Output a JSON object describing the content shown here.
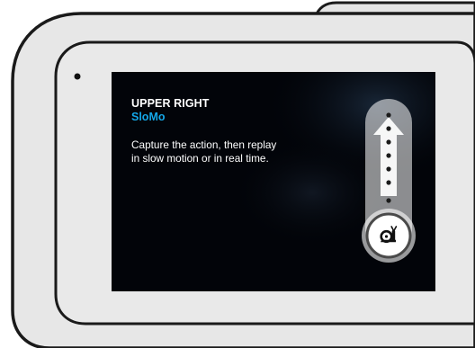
{
  "overlay": {
    "heading": "UPPER RIGHT",
    "mode_name": "SloMo",
    "description": "Capture the action, then replay in slow motion or in real time."
  },
  "gesture": {
    "direction": "swipe-up",
    "icon": "snail-icon"
  },
  "colors": {
    "mode_accent": "#14a7e8",
    "screen_background": "#020409",
    "device_body": "#e7e7e7",
    "device_outline": "#1a1a1a"
  }
}
